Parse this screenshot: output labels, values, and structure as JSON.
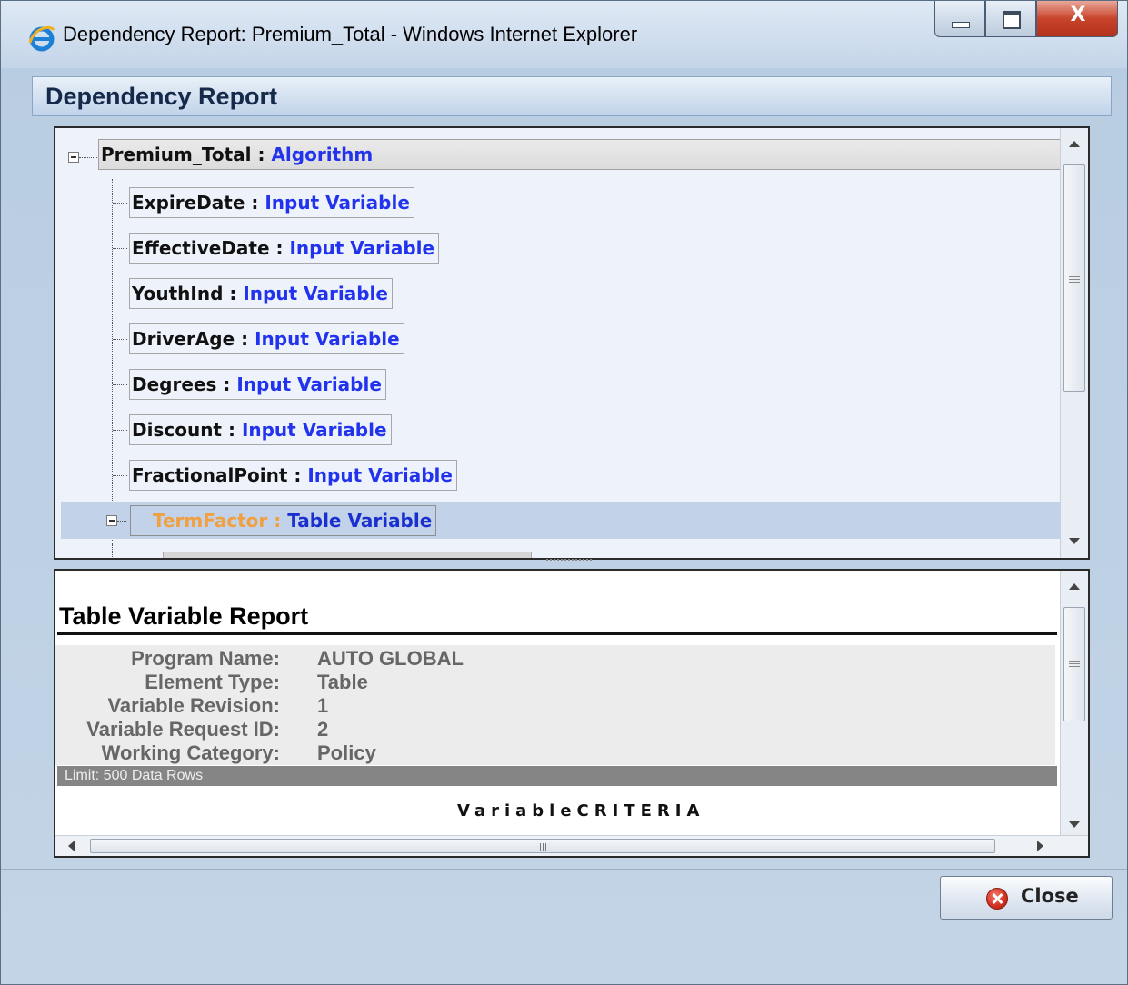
{
  "window": {
    "title": "Dependency Report: Premium_Total - Windows Internet Explorer",
    "close_glyph": "X"
  },
  "header": {
    "title": "Dependency Report"
  },
  "tree": {
    "root": {
      "name": "Premium_Total",
      "sep": " : ",
      "type": "Algorithm"
    },
    "children": [
      {
        "name": "ExpireDate",
        "sep": " : ",
        "type": "Input Variable"
      },
      {
        "name": "EffectiveDate",
        "sep": " : ",
        "type": "Input Variable"
      },
      {
        "name": "YouthInd",
        "sep": " : ",
        "type": "Input Variable"
      },
      {
        "name": "DriverAge",
        "sep": " : ",
        "type": "Input Variable"
      },
      {
        "name": "Degrees",
        "sep": " : ",
        "type": "Input Variable"
      },
      {
        "name": "Discount",
        "sep": " : ",
        "type": "Input Variable"
      },
      {
        "name": "FractionalPoint",
        "sep": " : ",
        "type": "Input Variable"
      }
    ],
    "selected": {
      "name": "TermFactor",
      "sep": " : ",
      "type": "Table Variable",
      "icon": "globe-icon"
    }
  },
  "report": {
    "title": "Table Variable Report",
    "rows": [
      {
        "label": "Program Name:",
        "value": "AUTO GLOBAL"
      },
      {
        "label": "Element Type:",
        "value": "Table"
      },
      {
        "label": "Variable Revision:",
        "value": "1"
      },
      {
        "label": "Variable Request ID:",
        "value": "2"
      },
      {
        "label": "Working Category:",
        "value": "Policy"
      }
    ],
    "limit": "Limit: 500 Data Rows",
    "criteria": "VariableCRITERIA"
  },
  "buttons": {
    "close_label": "Close"
  },
  "colors": {
    "type_blue": "#2233ee",
    "selected_name": "#f0a040",
    "selected_row": "#c2d2e8"
  }
}
